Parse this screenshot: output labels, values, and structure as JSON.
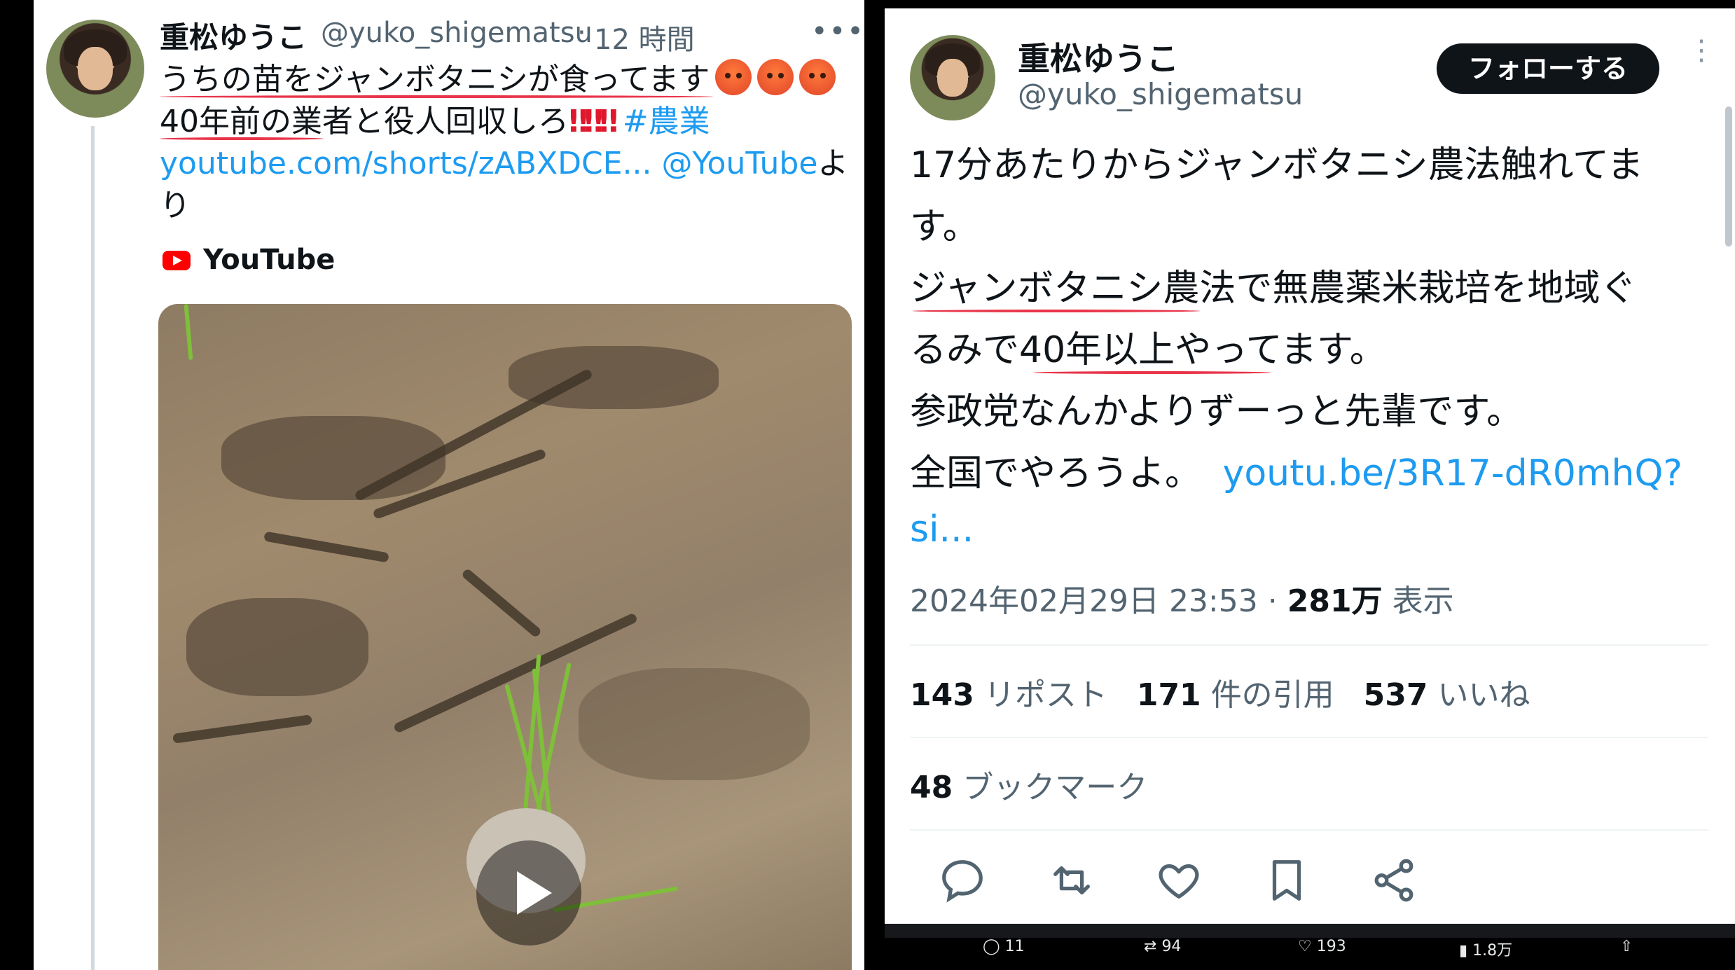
{
  "left_tweet": {
    "name": "重松ゆうこ",
    "handle": "@yuko_shigematsu",
    "separator": "·",
    "time": "12 時間",
    "more": "•••",
    "line1": "うちの苗をジャンボタニシが食ってます",
    "line2_text": "40年前の業者と役人回収しろ",
    "line2_bangs": "‼‼‼",
    "hashtag": "#農業",
    "link": "youtube.com/shorts/zABXDCE...",
    "mention": "@YouTube",
    "suffix": "よ",
    "line4": "り",
    "card_source": "YouTube"
  },
  "right_tweet": {
    "name": "重松ゆうこ",
    "handle": "@yuko_shigematsu",
    "follow_label": "フォローする",
    "more": "⋮",
    "lines": [
      "17分あたりからジャンボタニシ農法触れてま",
      "す。",
      "ジャンボタニシ農法で無農薬米栽培を地域ぐ",
      "るみで40年以上やってます。",
      "参政党なんかよりずーっと先輩です。",
      "全国でやろうよ。"
    ],
    "link_part1": "youtu.be/3R17-dR0mhQ?",
    "link_part2": "si...",
    "date": "2024年02月29日 23:53",
    "meta_sep": "·",
    "views_count": "281万",
    "views_label": "表示",
    "reposts_count": "143",
    "reposts_label": "リポスト",
    "quotes_count": "171",
    "quotes_label": "件の引用",
    "likes_count": "537",
    "likes_label": "いいね",
    "bookmarks_count": "48",
    "bookmarks_label": "ブックマーク",
    "bottom_bar": {
      "replies": "11",
      "reposts": "94",
      "likes": "193",
      "views": "1.8万"
    }
  },
  "colors": {
    "link": "#1d9bf0",
    "underline": "#e8354a",
    "text": "#0f1419",
    "muted": "#536471"
  },
  "icons": [
    "youtube-icon",
    "play-icon",
    "reply-icon",
    "repost-icon",
    "like-icon",
    "bookmark-icon",
    "share-icon",
    "views-icon",
    "upload-icon"
  ]
}
